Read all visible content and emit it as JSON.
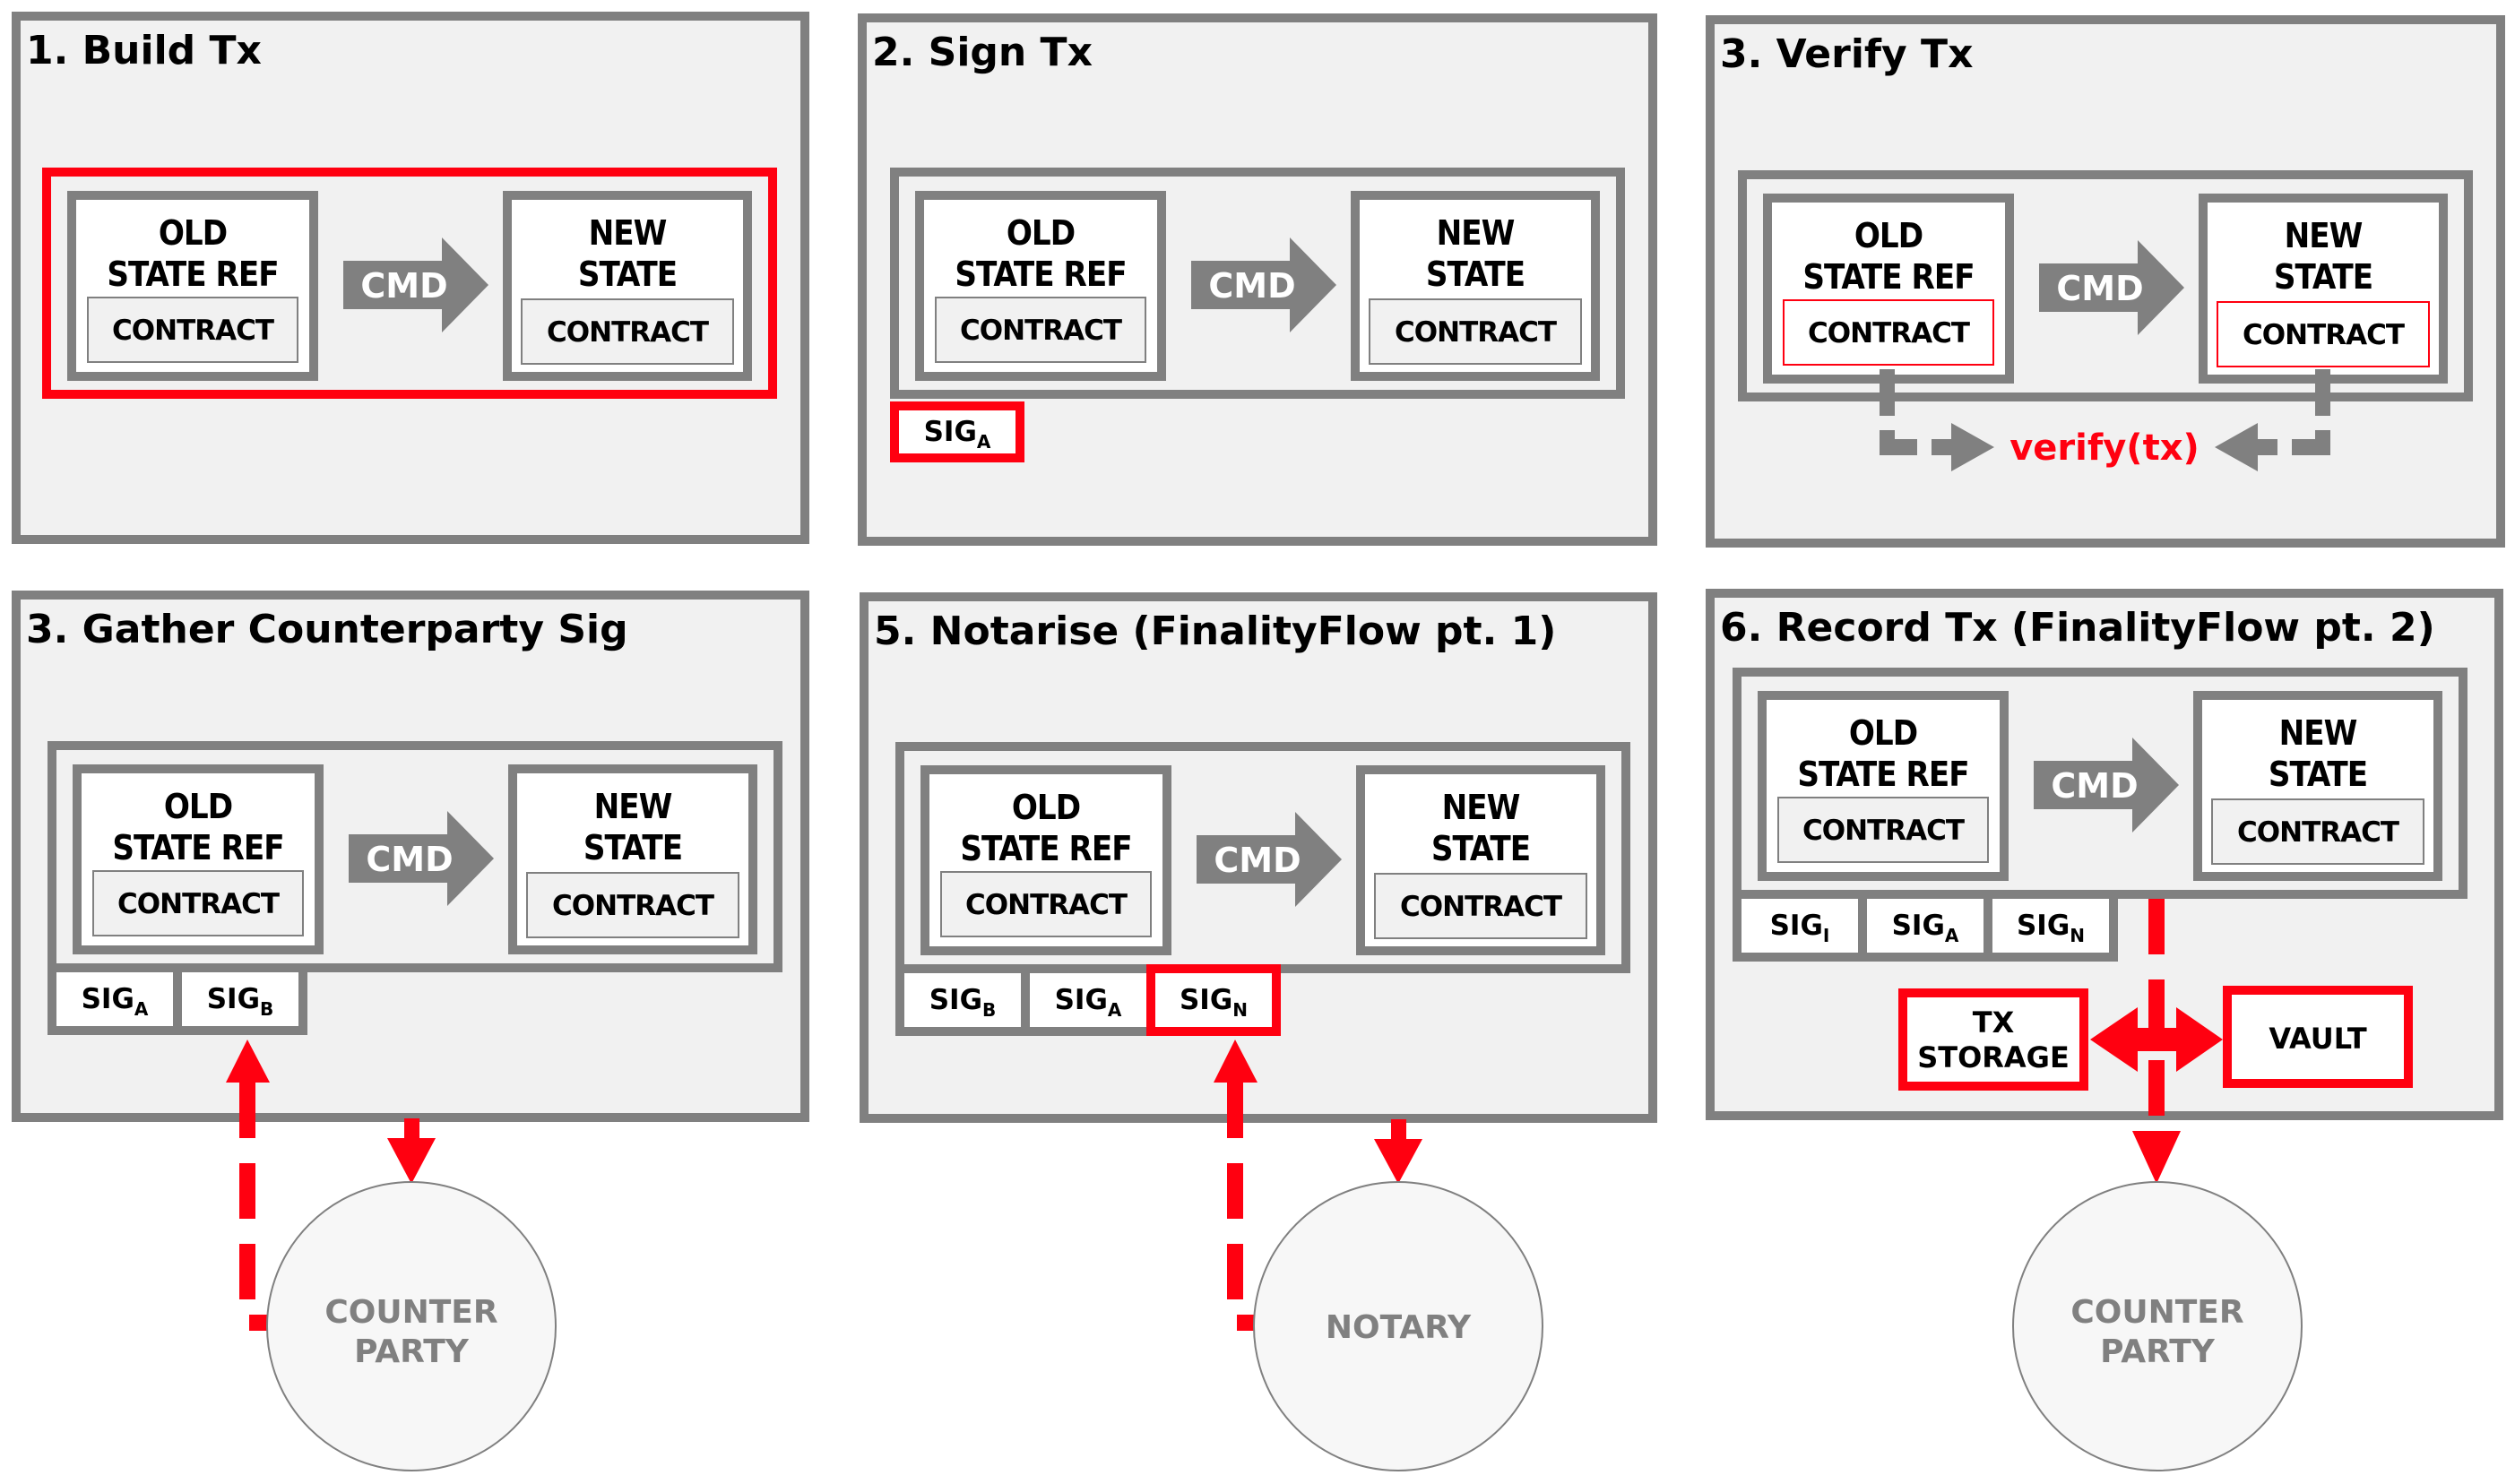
{
  "colors": {
    "panel_border": "#808080",
    "panel_fill": "#f1f1f1",
    "box_fill": "#ffffff",
    "highlight": "#ff0010",
    "node_fill": "#f7f7f7",
    "node_text": "#808080",
    "text": "#000000"
  },
  "labels": {
    "old_line1": "OLD",
    "old_line2": "STATE REF",
    "new_line1": "NEW",
    "new_line2": "STATE",
    "contract": "CONTRACT",
    "cmd": "CMD",
    "sig": "SIG"
  },
  "panels": [
    {
      "id": "build",
      "title": "1. Build Tx",
      "tx_highlighted": true,
      "contracts_highlighted": false,
      "signatures": []
    },
    {
      "id": "sign",
      "title": "2. Sign Tx",
      "tx_highlighted": false,
      "contracts_highlighted": false,
      "signatures": [
        {
          "sub": "A",
          "highlighted": true
        }
      ]
    },
    {
      "id": "verify",
      "title": "3. Verify Tx",
      "tx_highlighted": false,
      "contracts_highlighted": true,
      "verify_label": "verify(tx)",
      "signatures": []
    },
    {
      "id": "gather",
      "title": "3. Gather Counterparty Sig",
      "tx_highlighted": false,
      "contracts_highlighted": false,
      "signatures": [
        {
          "sub": "A",
          "highlighted": false
        },
        {
          "sub": "B",
          "highlighted": false
        }
      ],
      "node": {
        "line1": "COUNTER",
        "line2": "PARTY"
      }
    },
    {
      "id": "notarise",
      "title": "5. Notarise (FinalityFlow pt. 1)",
      "tx_highlighted": false,
      "contracts_highlighted": false,
      "signatures": [
        {
          "sub": "B",
          "highlighted": false
        },
        {
          "sub": "A",
          "highlighted": false
        },
        {
          "sub": "N",
          "highlighted": true
        }
      ],
      "node": {
        "line1": "NOTARY",
        "line2": ""
      }
    },
    {
      "id": "record",
      "title": "6. Record Tx (FinalityFlow pt. 2)",
      "tx_highlighted": false,
      "contracts_highlighted": false,
      "signatures": [
        {
          "sub": "I",
          "highlighted": false
        },
        {
          "sub": "A",
          "highlighted": false
        },
        {
          "sub": "N",
          "highlighted": false
        }
      ],
      "storage": {
        "tx_line1": "TX",
        "tx_line2": "STORAGE",
        "vault": "VAULT"
      },
      "node": {
        "line1": "COUNTER",
        "line2": "PARTY"
      }
    }
  ]
}
